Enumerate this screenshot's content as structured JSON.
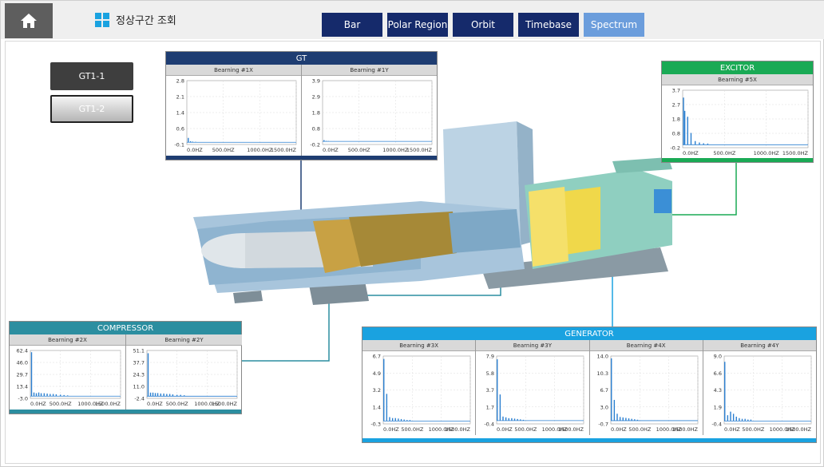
{
  "header": {
    "title": "정상구간 조회",
    "tabs": [
      {
        "label": "Bar",
        "active": false
      },
      {
        "label": "Polar Region",
        "active": false
      },
      {
        "label": "Orbit",
        "active": false
      },
      {
        "label": "Timebase",
        "active": false
      },
      {
        "label": "Spectrum",
        "active": true
      }
    ]
  },
  "units": [
    {
      "label": "GT1-1",
      "selected": false
    },
    {
      "label": "GT1-2",
      "selected": true
    }
  ],
  "colors": {
    "gt": "#1e3d72",
    "exciter": "#1aaa55",
    "compressor": "#2c8ea0",
    "generator": "#1aa2e0",
    "spectrum_line": "#2a7fd0"
  },
  "panels": {
    "gt": {
      "title": "GT"
    },
    "exciter": {
      "title": "EXCITOR"
    },
    "compressor": {
      "title": "COMPRESSOR"
    },
    "generator": {
      "title": "GENERATOR"
    }
  },
  "chart_data": [
    {
      "type": "bar",
      "group": "GT",
      "title": "Bearning #1X",
      "x_ticks": [
        "0.0HZ",
        "500.0HZ",
        "1000.0HZ",
        "1500.0HZ"
      ],
      "y_ticks": [
        "2.8",
        "2.1",
        "1.4",
        "0.6",
        "-0.1"
      ],
      "ylim": [
        -0.1,
        2.8
      ],
      "x": [
        20,
        50,
        80,
        120
      ],
      "values": [
        0.2,
        0.05,
        0.03,
        0.02
      ]
    },
    {
      "type": "bar",
      "group": "GT",
      "title": "Bearning #1Y",
      "x_ticks": [
        "0.0HZ",
        "500.0HZ",
        "1000.0HZ",
        "1500.0HZ"
      ],
      "y_ticks": [
        "3.9",
        "2.9",
        "1.8",
        "0.8",
        "-0.2"
      ],
      "ylim": [
        -0.2,
        3.9
      ],
      "x": [
        20,
        50,
        80
      ],
      "values": [
        0.08,
        0.03,
        0.02
      ]
    },
    {
      "type": "bar",
      "group": "EXCITOR",
      "title": "Bearning #5X",
      "x_ticks": [
        "0.0HZ",
        "500.0HZ",
        "1000.0HZ",
        "1500.0HZ"
      ],
      "y_ticks": [
        "3.7",
        "2.7",
        "1.8",
        "0.8",
        "-0.2"
      ],
      "ylim": [
        -0.2,
        3.7
      ],
      "x": [
        10,
        25,
        60,
        100,
        150,
        200,
        250,
        300
      ],
      "values": [
        3.2,
        2.3,
        1.9,
        0.8,
        0.25,
        0.15,
        0.1,
        0.08
      ]
    },
    {
      "type": "bar",
      "group": "COMPRESSOR",
      "title": "Bearning #2X",
      "x_ticks": [
        "0.0HZ",
        "500.0HZ",
        "1000.0HZ",
        "1500.0HZ"
      ],
      "y_ticks": [
        "62.4",
        "46.0",
        "29.7",
        "13.4",
        "-3.0"
      ],
      "ylim": [
        -3.0,
        62.4
      ],
      "x": [
        20,
        60,
        100,
        140,
        180,
        230,
        280,
        330,
        380,
        430,
        500,
        560,
        620
      ],
      "values": [
        60,
        5,
        4,
        5,
        4,
        4,
        3.5,
        3,
        3,
        2.5,
        2,
        1.5,
        1
      ]
    },
    {
      "type": "bar",
      "group": "COMPRESSOR",
      "title": "Bearning #2Y",
      "x_ticks": [
        "0.0HZ",
        "500.0HZ",
        "1000.0HZ",
        "1500.0HZ"
      ],
      "y_ticks": [
        "51.1",
        "37.7",
        "24.3",
        "11.0",
        "-2.4"
      ],
      "ylim": [
        -2.4,
        51.1
      ],
      "x": [
        20,
        60,
        100,
        140,
        180,
        230,
        280,
        330,
        380,
        430,
        500,
        560,
        620
      ],
      "values": [
        48,
        4,
        4,
        3.5,
        3.5,
        3,
        3,
        2.5,
        2.5,
        2,
        1.5,
        1.5,
        1
      ]
    },
    {
      "type": "bar",
      "group": "GENERATOR",
      "title": "Bearning #3X",
      "x_ticks": [
        "0.0HZ",
        "500.0HZ",
        "1000.0HZ",
        "1500.0HZ"
      ],
      "y_ticks": [
        "6.7",
        "4.9",
        "3.2",
        "1.4",
        "-0.3"
      ],
      "ylim": [
        -0.3,
        6.7
      ],
      "x": [
        10,
        60,
        110,
        160,
        210,
        260,
        310,
        360,
        410,
        460
      ],
      "values": [
        6.4,
        2.8,
        0.4,
        0.3,
        0.3,
        0.25,
        0.2,
        0.15,
        0.1,
        0.1
      ]
    },
    {
      "type": "bar",
      "group": "GENERATOR",
      "title": "Bearning #3Y",
      "x_ticks": [
        "0.0HZ",
        "500.0HZ",
        "1000.0HZ",
        "1500.0HZ"
      ],
      "y_ticks": [
        "7.9",
        "5.8",
        "3.7",
        "1.7",
        "-0.4"
      ],
      "ylim": [
        -0.4,
        7.9
      ],
      "x": [
        10,
        60,
        110,
        160,
        210,
        260,
        310,
        360,
        410,
        460
      ],
      "values": [
        7.5,
        3.2,
        0.5,
        0.4,
        0.3,
        0.3,
        0.25,
        0.2,
        0.15,
        0.1
      ]
    },
    {
      "type": "bar",
      "group": "GENERATOR",
      "title": "Bearning #4X",
      "x_ticks": [
        "0.0HZ",
        "500.0HZ",
        "1000.0HZ",
        "1500.0HZ"
      ],
      "y_ticks": [
        "14.0",
        "10.3",
        "6.7",
        "3.0",
        "-0.7"
      ],
      "ylim": [
        -0.7,
        14.0
      ],
      "x": [
        10,
        60,
        110,
        160,
        210,
        260,
        310,
        360,
        410,
        460
      ],
      "values": [
        13.5,
        4.5,
        1.5,
        0.8,
        0.7,
        0.6,
        0.5,
        0.4,
        0.3,
        0.2
      ]
    },
    {
      "type": "bar",
      "group": "GENERATOR",
      "title": "Bearning #4Y",
      "x_ticks": [
        "0.0HZ",
        "500.0HZ",
        "1000.0HZ",
        "1500.0HZ"
      ],
      "y_ticks": [
        "9.0",
        "6.6",
        "4.3",
        "1.9",
        "-0.4"
      ],
      "ylim": [
        -0.4,
        9.0
      ],
      "x": [
        10,
        60,
        110,
        160,
        210,
        260,
        310,
        360,
        410,
        460
      ],
      "values": [
        8.2,
        0.8,
        1.3,
        1.0,
        0.6,
        0.4,
        0.3,
        0.3,
        0.2,
        0.2
      ]
    }
  ]
}
